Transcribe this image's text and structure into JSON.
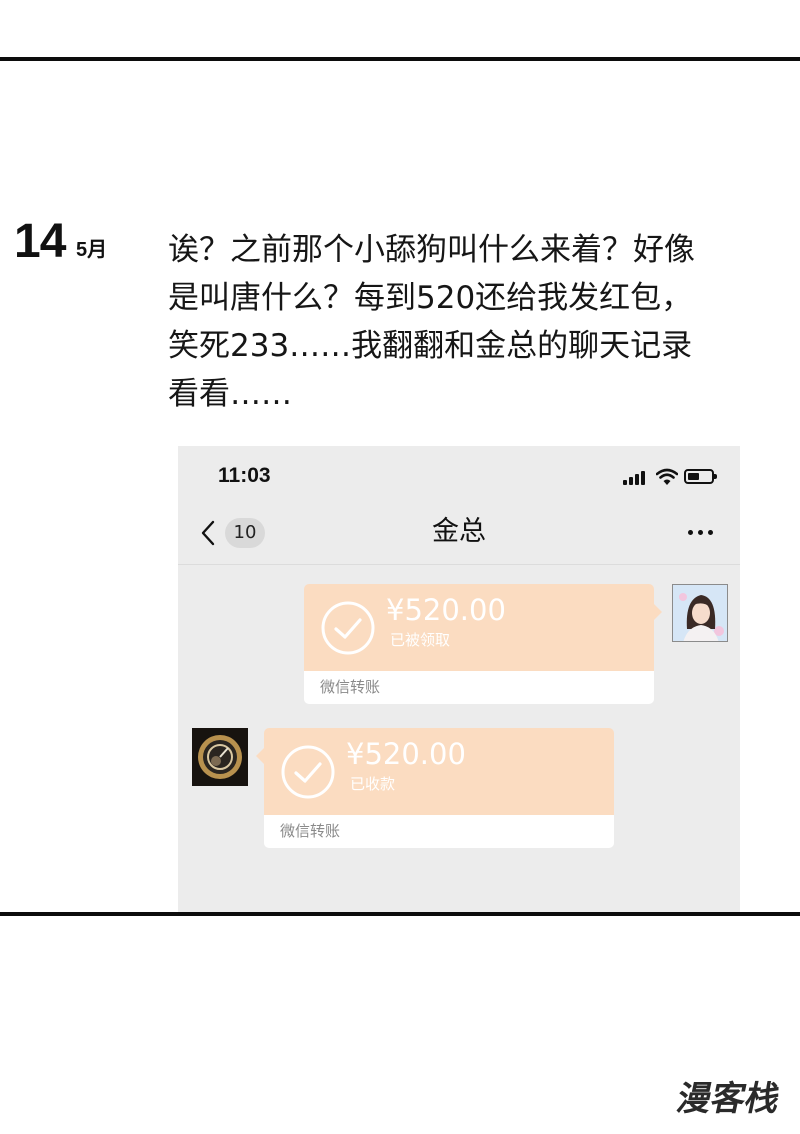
{
  "page": {
    "day": "14",
    "month": "5月",
    "entry_text": "诶？之前那个小舔狗叫什么来着？好像\n是叫唐什么？每到520还给我发红包，\n笑死233……我翻翻和金总的聊天记录\n看看……"
  },
  "screenshot": {
    "status_time": "11:03",
    "back_count": "10",
    "chat_title": "金总",
    "messages": [
      {
        "direction": "sent",
        "amount": "¥520.00",
        "status": "已被领取",
        "label": "微信转账"
      },
      {
        "direction": "received",
        "amount": "¥520.00",
        "status": "已收款",
        "label": "微信转账"
      }
    ]
  },
  "watermark": {
    "text": "漫客栈"
  },
  "colors": {
    "transfer_orange": "#fbdcc1",
    "chat_background": "#ececec",
    "rule": "#0c0c0c"
  },
  "icons": [
    "chevron-left-icon",
    "signal-icon",
    "wifi-icon",
    "battery-icon",
    "more-icon",
    "check-circle-icon"
  ]
}
